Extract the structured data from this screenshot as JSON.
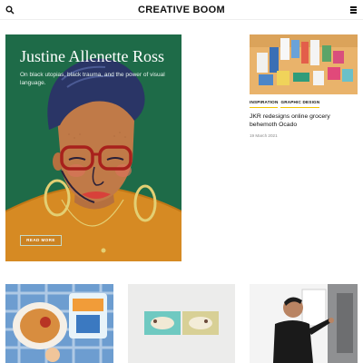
{
  "header": {
    "logo": "CREATIVE BOOM",
    "search_icon": "search-icon",
    "menu_icon": "hamburger-menu-icon"
  },
  "feature": {
    "title": "Justine Allenette Ross",
    "description": "On black utopias, black trauma, and the power of visual language.",
    "read_more": "READ MORE",
    "background": "#1e6b48"
  },
  "side_article": {
    "tags": [
      "INSPIRATION",
      "GRAPHIC DESIGN"
    ],
    "title": "JKR redesigns online grocery behemoth Ocado",
    "date": "19 March 2021",
    "tag_underline": "#f3c300"
  },
  "thumbnails": [
    {
      "image": "snack-food-on-picnic-table"
    },
    {
      "image": "dog-illustrated-packaging"
    },
    {
      "image": "man-writing-on-wall"
    }
  ]
}
